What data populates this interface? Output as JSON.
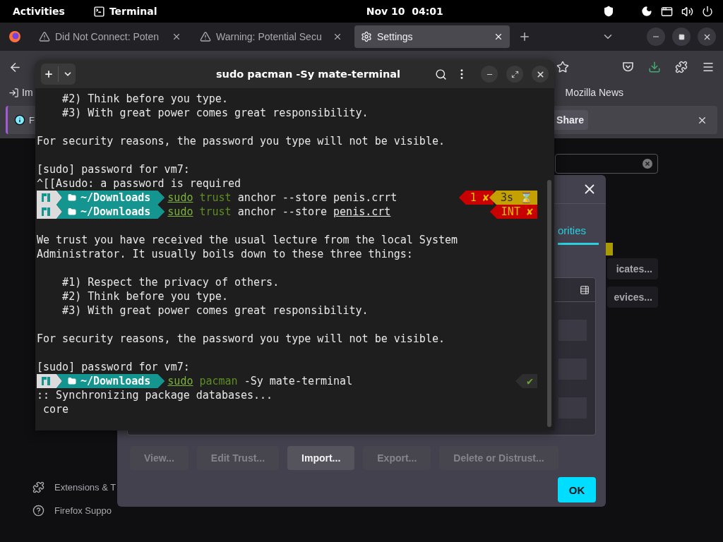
{
  "top_bar": {
    "activities": "Activities",
    "app": "Terminal",
    "clock": "Nov 10  04:01"
  },
  "browser": {
    "tabs": [
      {
        "kind": "warning",
        "label": "Did Not Connect: Poten",
        "selected": false
      },
      {
        "kind": "warning",
        "label": "Warning: Potential Secu",
        "selected": false
      },
      {
        "kind": "settings",
        "label": "Settings",
        "selected": true
      }
    ],
    "bookmarks": [
      {
        "kind": "import",
        "label": "Im"
      },
      {
        "kind": "plain",
        "label": "Mozilla News"
      }
    ],
    "notification": {
      "text": "F",
      "button": "Share"
    },
    "sidebar": [
      {
        "kind": "extensions",
        "label": "Extensions & T"
      },
      {
        "kind": "support",
        "label": "Firefox Suppo"
      }
    ],
    "side_buttons": [
      "icates...",
      "evices..."
    ]
  },
  "dialog": {
    "tab": {
      "label": "orities",
      "selected": true
    },
    "buttons": [
      {
        "label": "View...",
        "disabled": true
      },
      {
        "label": "Edit Trust...",
        "disabled": true
      },
      {
        "label": "Import...",
        "disabled": false
      },
      {
        "label": "Export...",
        "disabled": true
      },
      {
        "label": "Delete or Distrust...",
        "disabled": true
      }
    ],
    "ok": "OK"
  },
  "terminal": {
    "title": "sudo pacman -Sy mate-terminal",
    "lines": [
      {
        "kind": "text",
        "text": "    #2) Think before you type."
      },
      {
        "kind": "text",
        "text": "    #3) With great power comes great responsibility."
      },
      {
        "kind": "blank"
      },
      {
        "kind": "text",
        "text": "For security reasons, the password you type will not be visible."
      },
      {
        "kind": "blank"
      },
      {
        "kind": "text",
        "text": "[sudo] password for vm7:"
      },
      {
        "kind": "text",
        "text": "^[[Asudo: a password is required"
      },
      {
        "kind": "prompt",
        "dir": "~/Downloads",
        "command": [
          {
            "kind": "sudo",
            "text": "sudo"
          },
          {
            "kind": "program",
            "text": "trust"
          },
          {
            "kind": "plain",
            "text": "anchor --store"
          },
          {
            "kind": "plain",
            "text": "penis.crrt"
          }
        ],
        "status": [
          {
            "kind": "error",
            "text": "1 ✘"
          },
          {
            "kind": "duration",
            "text": "3s ⌛"
          }
        ]
      },
      {
        "kind": "prompt",
        "dir": "~/Downloads",
        "command": [
          {
            "kind": "sudo",
            "text": "sudo"
          },
          {
            "kind": "program",
            "text": "trust"
          },
          {
            "kind": "plain",
            "text": "anchor --store"
          },
          {
            "kind": "path",
            "text": "penis.crt"
          }
        ],
        "status": [
          {
            "kind": "interrupt",
            "text": "INT ✘"
          }
        ]
      },
      {
        "kind": "blank"
      },
      {
        "kind": "text",
        "text": "We trust you have received the usual lecture from the local System"
      },
      {
        "kind": "text",
        "text": "Administrator. It usually boils down to these three things:"
      },
      {
        "kind": "blank"
      },
      {
        "kind": "text",
        "text": "    #1) Respect the privacy of others."
      },
      {
        "kind": "text",
        "text": "    #2) Think before you type."
      },
      {
        "kind": "text",
        "text": "    #3) With great power comes great responsibility."
      },
      {
        "kind": "blank"
      },
      {
        "kind": "text",
        "text": "For security reasons, the password you type will not be visible."
      },
      {
        "kind": "blank"
      },
      {
        "kind": "text",
        "text": "[sudo] password for vm7:"
      },
      {
        "kind": "prompt",
        "dir": "~/Downloads",
        "command": [
          {
            "kind": "sudo",
            "text": "sudo"
          },
          {
            "kind": "program",
            "text": "pacman"
          },
          {
            "kind": "plain",
            "text": "-Sy mate-terminal"
          }
        ],
        "status": [
          {
            "kind": "ok",
            "text": "✔"
          }
        ]
      },
      {
        "kind": "text",
        "text": ":: Synchronizing package databases..."
      },
      {
        "kind": "text",
        "text": " core"
      }
    ]
  }
}
